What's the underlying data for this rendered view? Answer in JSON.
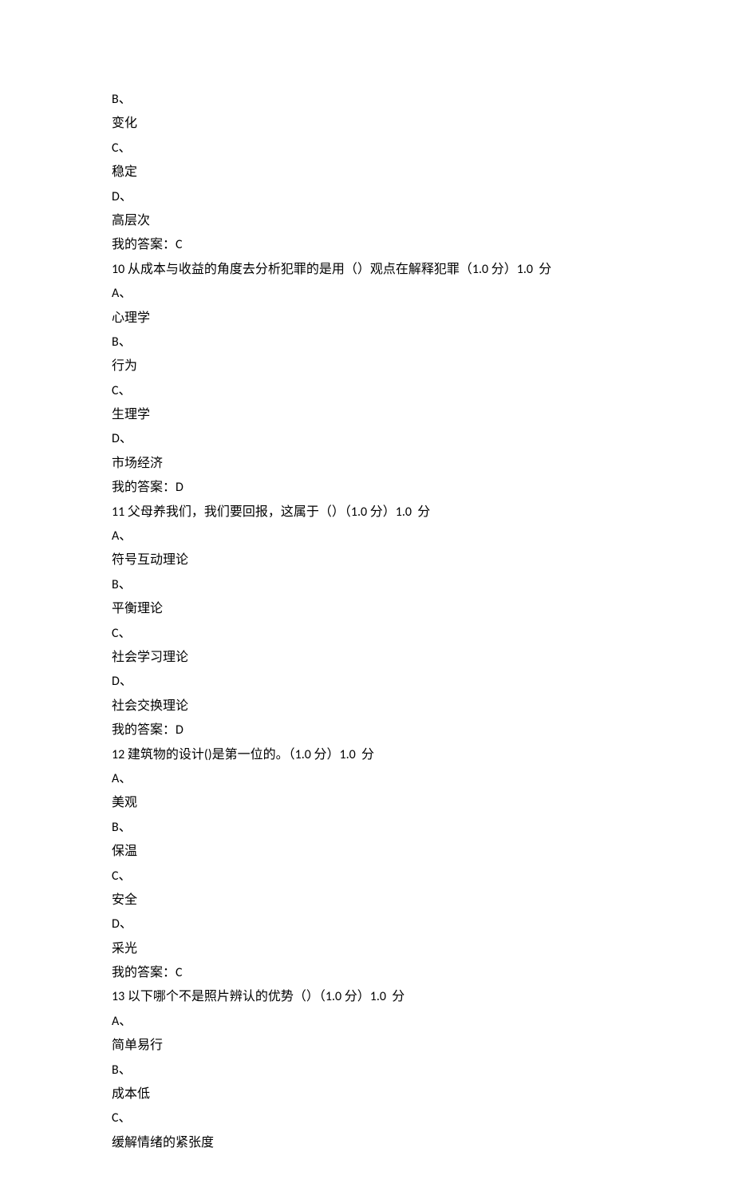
{
  "lines": [
    {
      "text": "B、",
      "latin": true
    },
    {
      "text": "变化"
    },
    {
      "text": "C、",
      "latin": true
    },
    {
      "text": "稳定"
    },
    {
      "text": "D、",
      "latin": true
    },
    {
      "text": "高层次"
    },
    {
      "segments": [
        {
          "t": "我的答案："
        },
        {
          "t": "C",
          "latin": true
        }
      ]
    },
    {
      "segments": [
        {
          "t": "10 ",
          "latin": true
        },
        {
          "t": "从成本与收益的角度去分析犯罪的是用（）观点在解释犯罪（"
        },
        {
          "t": "1.0 ",
          "latin": true
        },
        {
          "t": "分）"
        },
        {
          "t": "1.0  ",
          "latin": true
        },
        {
          "t": "分"
        }
      ]
    },
    {
      "text": "A、",
      "latin": true
    },
    {
      "text": "心理学"
    },
    {
      "text": "B、",
      "latin": true
    },
    {
      "text": "行为"
    },
    {
      "text": "C、",
      "latin": true
    },
    {
      "text": "生理学"
    },
    {
      "text": "D、",
      "latin": true
    },
    {
      "text": "市场经济"
    },
    {
      "segments": [
        {
          "t": "我的答案："
        },
        {
          "t": "D",
          "latin": true
        }
      ]
    },
    {
      "segments": [
        {
          "t": "11 ",
          "latin": true
        },
        {
          "t": "父母养我们，我们要回报，这属于（）（"
        },
        {
          "t": "1.0 ",
          "latin": true
        },
        {
          "t": "分）"
        },
        {
          "t": "1.0  ",
          "latin": true
        },
        {
          "t": "分"
        }
      ]
    },
    {
      "text": "A、",
      "latin": true
    },
    {
      "text": "符号互动理论"
    },
    {
      "text": "B、",
      "latin": true
    },
    {
      "text": "平衡理论"
    },
    {
      "text": "C、",
      "latin": true
    },
    {
      "text": "社会学习理论"
    },
    {
      "text": "D、",
      "latin": true
    },
    {
      "text": "社会交换理论"
    },
    {
      "segments": [
        {
          "t": "我的答案："
        },
        {
          "t": "D",
          "latin": true
        }
      ]
    },
    {
      "segments": [
        {
          "t": "12 ",
          "latin": true
        },
        {
          "t": "建筑物的设计"
        },
        {
          "t": "()",
          "latin": true
        },
        {
          "t": "是第一位的。（"
        },
        {
          "t": "1.0 ",
          "latin": true
        },
        {
          "t": "分）"
        },
        {
          "t": "1.0  ",
          "latin": true
        },
        {
          "t": "分"
        }
      ]
    },
    {
      "text": "A、",
      "latin": true
    },
    {
      "text": "美观"
    },
    {
      "text": "B、",
      "latin": true
    },
    {
      "text": "保温"
    },
    {
      "text": "C、",
      "latin": true
    },
    {
      "text": "安全"
    },
    {
      "text": "D、",
      "latin": true
    },
    {
      "text": "采光"
    },
    {
      "segments": [
        {
          "t": "我的答案："
        },
        {
          "t": "C",
          "latin": true
        }
      ]
    },
    {
      "segments": [
        {
          "t": "13 ",
          "latin": true
        },
        {
          "t": "以下哪个不是照片辨认的优势（）（"
        },
        {
          "t": "1.0 ",
          "latin": true
        },
        {
          "t": "分）"
        },
        {
          "t": "1.0  ",
          "latin": true
        },
        {
          "t": "分"
        }
      ]
    },
    {
      "text": "A、",
      "latin": true
    },
    {
      "text": "简单易行"
    },
    {
      "text": "B、",
      "latin": true
    },
    {
      "text": "成本低"
    },
    {
      "text": "C、",
      "latin": true
    },
    {
      "text": "缓解情绪的紧张度"
    }
  ]
}
